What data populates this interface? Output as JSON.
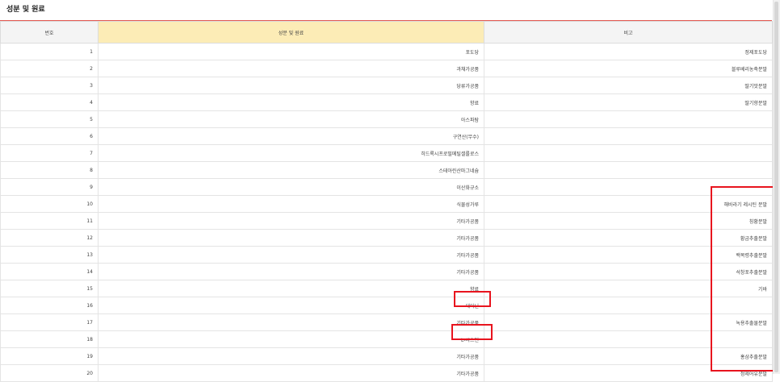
{
  "section": {
    "title": "성분 및 원료"
  },
  "table": {
    "headers": [
      "번호",
      "성분 및 원료",
      "비고"
    ],
    "rows": [
      {
        "no": "1",
        "ingredient": "포도당",
        "note": "정제포도당"
      },
      {
        "no": "2",
        "ingredient": "과채가공품",
        "note": "블루베리농축분말"
      },
      {
        "no": "3",
        "ingredient": "당류가공품",
        "note": "딸기맛분말"
      },
      {
        "no": "4",
        "ingredient": "향료",
        "note": "딸기향분말"
      },
      {
        "no": "5",
        "ingredient": "아스파탐",
        "note": ""
      },
      {
        "no": "6",
        "ingredient": "구연산(무수)",
        "note": ""
      },
      {
        "no": "7",
        "ingredient": "히드록시프로필메틸셀룰로스",
        "note": ""
      },
      {
        "no": "8",
        "ingredient": "스테아린산마그네슘",
        "note": ""
      },
      {
        "no": "9",
        "ingredient": "이산화규소",
        "note": ""
      },
      {
        "no": "10",
        "ingredient": "식물성가루",
        "note": "해바라기 레시틴 분말"
      },
      {
        "no": "11",
        "ingredient": "기타가공품",
        "note": "칭황분말"
      },
      {
        "no": "12",
        "ingredient": "기타가공품",
        "note": "황금추출분말"
      },
      {
        "no": "13",
        "ingredient": "기타가공품",
        "note": "백복령추출분말"
      },
      {
        "no": "14",
        "ingredient": "기타가공품",
        "note": "석창포추출분말"
      },
      {
        "no": "15",
        "ingredient": "향료",
        "note": "기바"
      },
      {
        "no": "16",
        "ingredient": "테아닌",
        "note": ""
      },
      {
        "no": "17",
        "ingredient": "기타가공품",
        "note": "녹용추출물분말"
      },
      {
        "no": "18",
        "ingredient": "L-시스틴",
        "note": ""
      },
      {
        "no": "19",
        "ingredient": "기타가공품",
        "note": "홍삼추출분말"
      },
      {
        "no": "20",
        "ingredient": "기타가공품",
        "note": "정제어유분말"
      }
    ]
  },
  "colors": {
    "header_accent_border": "#e3574f",
    "header_highlight_bg": "#fcecb6",
    "annotation_red": "#e8141e"
  }
}
